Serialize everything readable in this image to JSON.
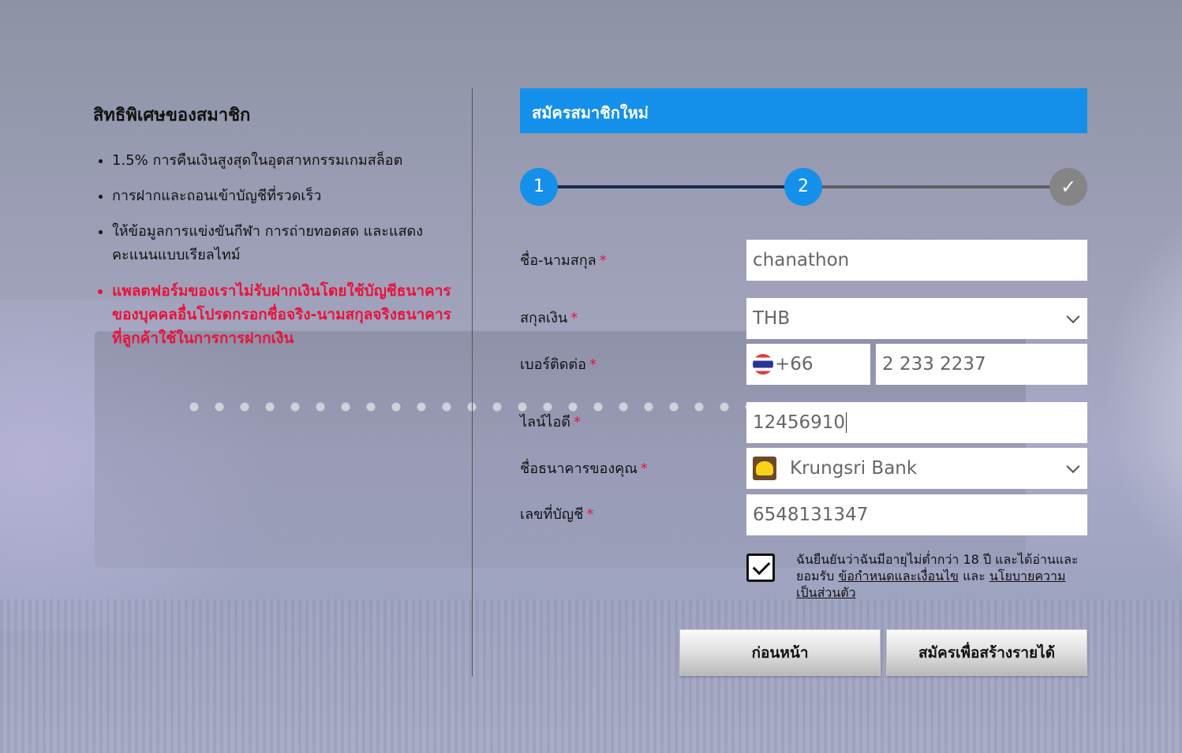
{
  "benefits": {
    "title": "สิทธิพิเศษของสมาชิก",
    "items": [
      "1.5% การคืนเงินสูงสุดในอุตสาหกรรมเกมสล็อต",
      "การฝากและถอนเข้าบัญชีที่รวดเร็ว",
      "ให้ข้อมูลการแข่งขันกีฬา การถ่ายทอดสด และแสดงคะแนนแบบเรียลไทม์"
    ],
    "warning": "แพลตฟอร์มของเราไม่รับฝากเงินโดยใช้บัญชีธนาคารของบุคคลอื่นโปรดกรอกชื่อจริง-นามสกุลจริงธนาคารที่ลูกค้าใช้ในการการฝากเงิน"
  },
  "form": {
    "title": "สมัครสมาชิกใหม่",
    "steps": {
      "step1": "1",
      "step2": "2",
      "step3": "✓",
      "current": 2
    },
    "required_mark": "*",
    "fullname": {
      "label": "ชื่อ-นามสกุล",
      "value": "chanathon"
    },
    "currency": {
      "label": "สกุลเงิน",
      "value": "THB"
    },
    "phone": {
      "label": "เบอร์ติดต่อ",
      "country_code": "+66",
      "number": "2 233 2237"
    },
    "line_id": {
      "label": "ไลน์ไอดี",
      "value": "12456910"
    },
    "bank": {
      "label": "ชื่อธนาคารของคุณ",
      "value": "Krungsri Bank"
    },
    "account": {
      "label": "เลขที่บัญชี",
      "value": "6548131347"
    },
    "agreement": {
      "checked": true,
      "text_before": "ฉันยืนยันว่าฉันมีอายุไม่ต่ำกว่า 18 ปี และได้อ่านและยอมรับ",
      "terms_link": "ข้อกำหนดและเงื่อนไข",
      "and": "และ",
      "privacy_link": "นโยบายความเป็นส่วนตัว"
    },
    "buttons": {
      "back": "ก่อนหน้า",
      "submit": "สมัครเพื่อสร้างรายได้"
    }
  },
  "icons": {
    "select_arrow": "chevron-down-icon",
    "flag": "thailand-flag-icon",
    "bank_logo": "krungsri-logo-icon",
    "check": "checkmark-icon"
  },
  "colors": {
    "accent": "#1490ea",
    "required": "#e8133c",
    "step_done_line": "#19294b",
    "step_pending": "#858585"
  }
}
